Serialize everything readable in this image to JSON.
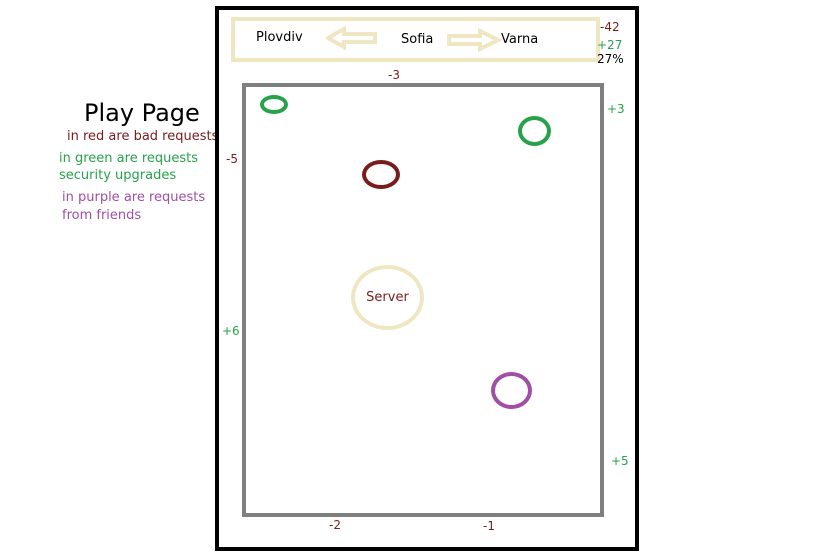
{
  "legend": {
    "title": "Play Page",
    "red": "in red are bad requests",
    "green_line1": "in green are requests",
    "green_line2": "security upgrades",
    "purple_line1": "in purple are requests",
    "purple_line2": "from friends"
  },
  "topbar": {
    "city_left": "Plovdiv",
    "city_center": "Sofia",
    "city_right": "Varna"
  },
  "stats": {
    "bad": "-42",
    "good": "+27",
    "percent": "27%"
  },
  "edges": {
    "top": "-3",
    "left_upper": "-5",
    "left_lower": "+6",
    "right_upper": "+3",
    "right_lower": "+5",
    "bottom_left": "-2",
    "bottom_right": "-1"
  },
  "server": {
    "label": "Server"
  },
  "requests": [
    {
      "type": "green",
      "color": "#27a24a"
    },
    {
      "type": "green",
      "color": "#27a24a"
    },
    {
      "type": "red",
      "color": "#7a1c1c"
    },
    {
      "type": "purple",
      "color": "#a04ea6"
    }
  ],
  "colors": {
    "bad": "#7a1c1c",
    "security": "#27a24a",
    "friends": "#a04ea6",
    "frame": "#000000",
    "arena": "#7f7f7f",
    "accent": "#efe6c2"
  }
}
